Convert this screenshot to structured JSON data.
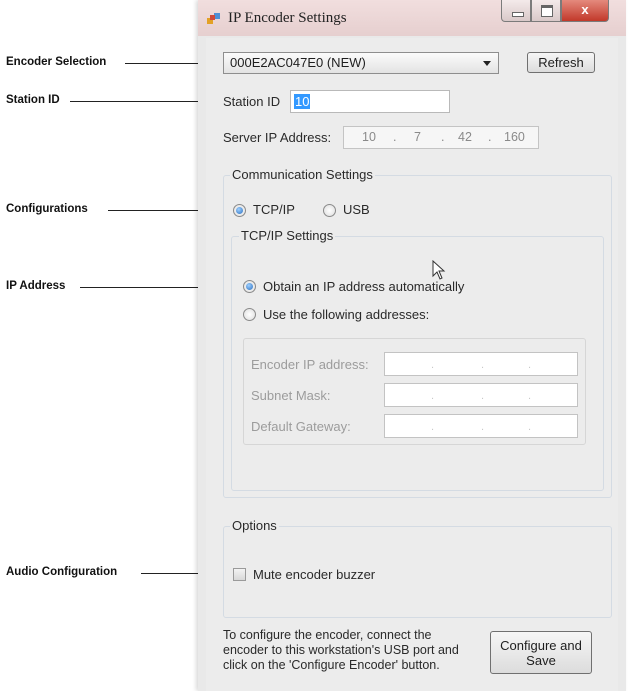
{
  "annotations": {
    "encoder_selection": "Encoder Selection",
    "station_id": "Station ID",
    "configurations": "Configurations",
    "ip_address": "IP Address",
    "audio_configuration": "Audio Configuration"
  },
  "window": {
    "title": "IP Encoder Settings",
    "close_glyph": "x",
    "icon": "app-icon"
  },
  "encoder": {
    "selected": "000E2AC047E0  (NEW)",
    "refresh_label": "Refresh"
  },
  "station": {
    "label": "Station ID",
    "value": "10"
  },
  "server_ip": {
    "label": "Server IP Address:",
    "octets": [
      "10",
      "7",
      "42",
      "160"
    ]
  },
  "communication": {
    "title": "Communication Settings",
    "tcpip_label": "TCP/IP",
    "usb_label": "USB",
    "selected": "TCP/IP"
  },
  "tcpip_settings": {
    "title": "TCP/IP Settings",
    "auto_label": "Obtain an IP address automatically",
    "manual_label": "Use the following addresses:",
    "selected": "auto",
    "encoder_ip_label": "Encoder IP address:",
    "subnet_label": "Subnet Mask:",
    "gateway_label": "Default Gateway:"
  },
  "options": {
    "title": "Options",
    "mute_label": "Mute encoder buzzer",
    "mute_checked": false
  },
  "footer": {
    "instructions_1": "To configure the encoder, connect the",
    "instructions_2": "encoder to this workstation's USB port and",
    "instructions_3": "click on the 'Configure Encoder' button.",
    "configure_label_1": "Configure and",
    "configure_label_2": "Save"
  },
  "colors": {
    "selection": "#3399ff",
    "radio_selected": "#2a6fbf",
    "close_button": "#c2392a"
  }
}
